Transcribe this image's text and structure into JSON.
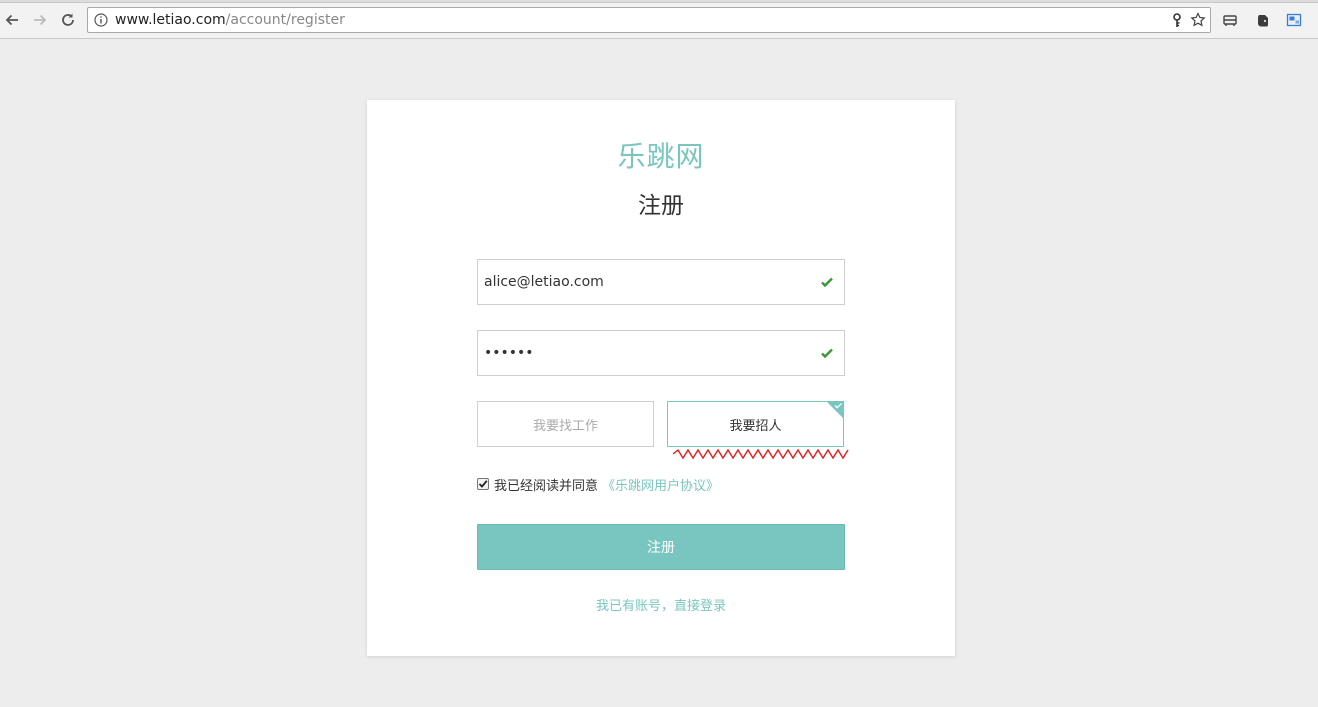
{
  "browser": {
    "url_host": "www.letiao.com",
    "url_path": "/account/register"
  },
  "page": {
    "brand": "乐跳网",
    "heading": "注册",
    "email_value": "alice@letiao.com",
    "password_value": "••••••",
    "role_options": [
      "我要找工作",
      "我要招人"
    ],
    "selected_role": "我要招人",
    "agree_text": "我已经阅读并同意",
    "agreement_link": "《乐跳网用户协议》",
    "agree_checked": true,
    "submit_label": "注册",
    "login_link": "我已有账号，直接登录"
  },
  "colors": {
    "accent": "#78c6bf",
    "valid": "#3a9a3a",
    "spellcheck": "#e02020"
  }
}
